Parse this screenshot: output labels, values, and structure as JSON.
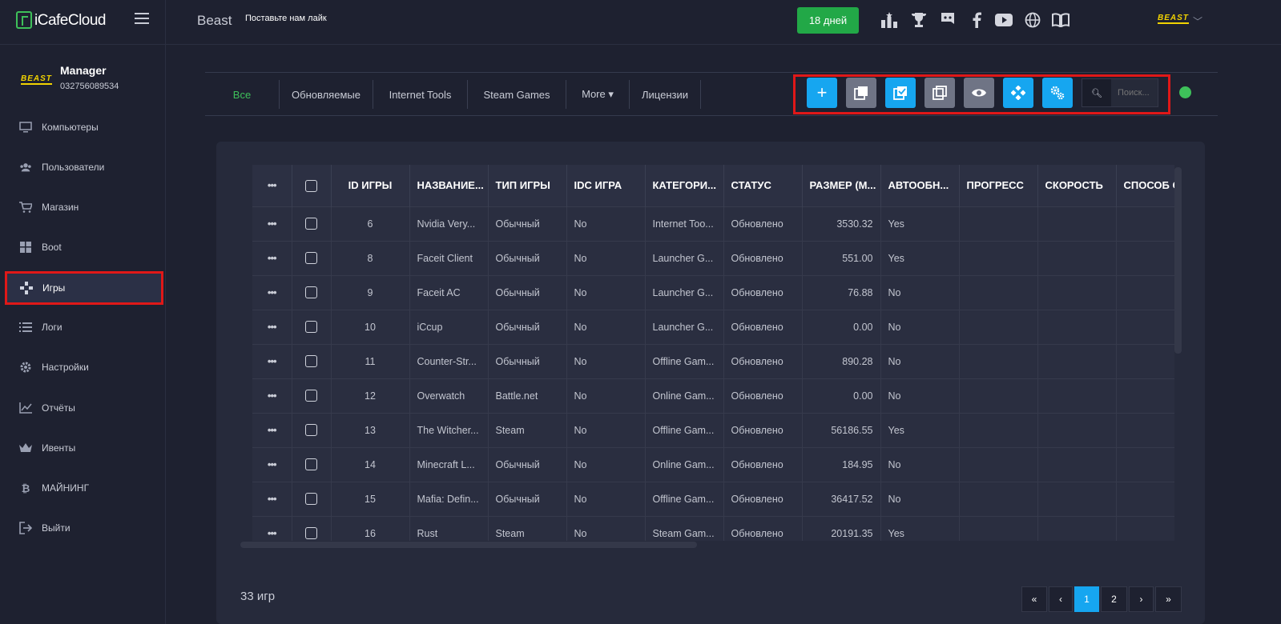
{
  "header": {
    "logo_text": "iCafeCloud",
    "cafe_name": "Beast",
    "cafe_note": "Поставьте нам лайк",
    "days_label": "18 дней",
    "account_logo": "BEAST",
    "icons": [
      "ranking-icon",
      "trophy-icon",
      "discord-icon",
      "facebook-icon",
      "youtube-icon",
      "globe-icon",
      "book-icon"
    ]
  },
  "sidebar": {
    "user_name": "Manager",
    "user_id": "032756089534",
    "avatar_logo": "BEAST",
    "items": [
      {
        "label": "Компьютеры",
        "icon": "monitor-icon"
      },
      {
        "label": "Пользователи",
        "icon": "users-icon"
      },
      {
        "label": "Магазин",
        "icon": "cart-icon"
      },
      {
        "label": "Boot",
        "icon": "windows-icon"
      },
      {
        "label": "Игры",
        "icon": "gamepad-icon"
      },
      {
        "label": "Логи",
        "icon": "list-icon"
      },
      {
        "label": "Настройки",
        "icon": "gear-icon"
      },
      {
        "label": "Отчёты",
        "icon": "chart-icon"
      },
      {
        "label": "Ивенты",
        "icon": "crown-icon"
      },
      {
        "label": "МАЙНИНГ",
        "icon": "bitcoin-icon"
      },
      {
        "label": "Выйти",
        "icon": "logout-icon"
      }
    ],
    "active_index": 4
  },
  "tabs": [
    "Все",
    "Обновляемые",
    "Internet Tools",
    "Steam Games",
    "More ▾",
    "Лицензии"
  ],
  "toolbar": {
    "buttons": [
      {
        "icon": "plus-icon",
        "color": "#16a6f0"
      },
      {
        "icon": "copy-icon",
        "color": "#6f7485"
      },
      {
        "icon": "checked-copy-icon",
        "color": "#16a6f0"
      },
      {
        "icon": "copy-outline-icon",
        "color": "#6f7485"
      },
      {
        "icon": "eye-icon",
        "color": "#6f7485"
      },
      {
        "icon": "diamonds-icon",
        "color": "#16a6f0"
      },
      {
        "icon": "gears-icon",
        "color": "#16a6f0"
      }
    ],
    "search_placeholder": "Поиск..."
  },
  "table": {
    "columns": [
      "ID ИГРЫ",
      "НАЗВАНИЕ...",
      "ТИП ИГРЫ",
      "IDC ИГРА",
      "КАТЕГОРИ...",
      "СТАТУС",
      "РАЗМЕР (М...",
      "АВТООБН...",
      "ПРОГРЕСС",
      "СКОРОСТЬ",
      "СПОСОБ С"
    ],
    "rows": [
      {
        "id": "6",
        "name": "Nvidia Very...",
        "type": "Обычный",
        "idc": "No",
        "cat": "Internet Too...",
        "status": "Обновлено",
        "size": "3530.32",
        "auto": "Yes"
      },
      {
        "id": "8",
        "name": "Faceit Client",
        "type": "Обычный",
        "idc": "No",
        "cat": "Launcher G...",
        "status": "Обновлено",
        "size": "551.00",
        "auto": "Yes"
      },
      {
        "id": "9",
        "name": "Faceit AC",
        "type": "Обычный",
        "idc": "No",
        "cat": "Launcher G...",
        "status": "Обновлено",
        "size": "76.88",
        "auto": "No"
      },
      {
        "id": "10",
        "name": "iCcup",
        "type": "Обычный",
        "idc": "No",
        "cat": "Launcher G...",
        "status": "Обновлено",
        "size": "0.00",
        "auto": "No"
      },
      {
        "id": "11",
        "name": "Counter-Str...",
        "type": "Обычный",
        "idc": "No",
        "cat": "Offline Gam...",
        "status": "Обновлено",
        "size": "890.28",
        "auto": "No"
      },
      {
        "id": "12",
        "name": "Overwatch",
        "type": "Battle.net",
        "idc": "No",
        "cat": "Online Gam...",
        "status": "Обновлено",
        "size": "0.00",
        "auto": "No"
      },
      {
        "id": "13",
        "name": "The Witcher...",
        "type": "Steam",
        "idc": "No",
        "cat": "Offline Gam...",
        "status": "Обновлено",
        "size": "56186.55",
        "auto": "Yes"
      },
      {
        "id": "14",
        "name": "Minecraft L...",
        "type": "Обычный",
        "idc": "No",
        "cat": "Online Gam...",
        "status": "Обновлено",
        "size": "184.95",
        "auto": "No"
      },
      {
        "id": "15",
        "name": "Mafia: Defin...",
        "type": "Обычный",
        "idc": "No",
        "cat": "Offline Gam...",
        "status": "Обновлено",
        "size": "36417.52",
        "auto": "No"
      },
      {
        "id": "16",
        "name": "Rust",
        "type": "Steam",
        "idc": "No",
        "cat": "Steam Gam...",
        "status": "Обновлено",
        "size": "20191.35",
        "auto": "Yes"
      }
    ]
  },
  "footer": {
    "count_label": "33 игр",
    "pages": [
      "«",
      "‹",
      "1",
      "2",
      "›",
      "»"
    ],
    "active_page": "1"
  }
}
